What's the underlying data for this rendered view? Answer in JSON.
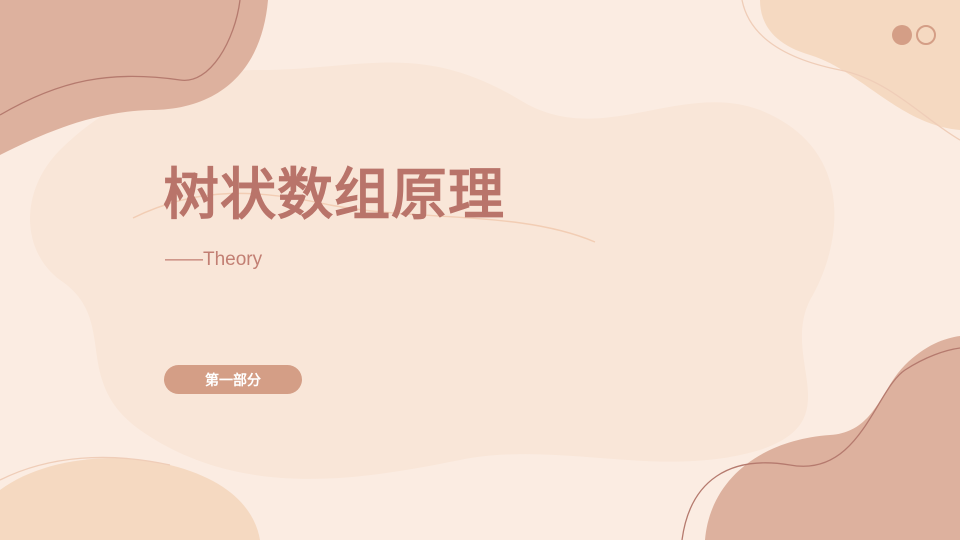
{
  "slide": {
    "title": "树状数组原理",
    "subtitle": "——Theory",
    "section_label": "第一部分"
  },
  "colors": {
    "background": "#fbece2",
    "blob_light": "#f9e6d8",
    "blob_rose": "#ddb19e",
    "blob_peach": "#f5d9c1",
    "title": "#b9746a",
    "accent": "#d49e86"
  },
  "icons": [
    "decorative-dots-icon"
  ]
}
